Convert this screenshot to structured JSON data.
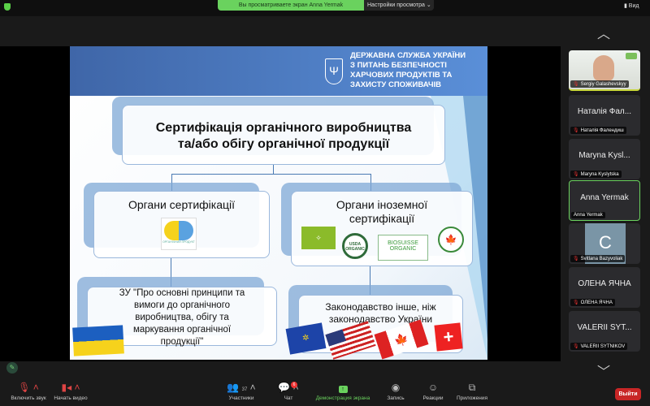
{
  "topbar": {
    "sharing_text": "Вы просматриваете экран Anna Yermak",
    "view_options": "Настройки просмотра",
    "view_button": "Вид"
  },
  "slide": {
    "agency": [
      "ДЕРЖАВНА СЛУЖБА УКРАЇНИ",
      "З ПИТАНЬ БЕЗПЕЧНОСТІ",
      "ХАРЧОВИХ ПРОДУКТІВ  ТА",
      "ЗАХИСТУ СПОЖИВАЧІВ"
    ],
    "title": [
      "Сертифікація органічного виробництва",
      "та/або обігу органічної продукції"
    ],
    "left_box": "Органи сертифікації",
    "right_box": [
      "Органи іноземної",
      "сертифікації"
    ],
    "left_bottom": [
      "ЗУ \"Про основні принципи та",
      "вимоги до органічного",
      "виробництва, обігу та",
      "маркування органічної",
      "продукції\""
    ],
    "right_bottom": [
      "Законодавство інше, ніж",
      "законодавство України"
    ],
    "logos": {
      "ua_organic": "ОРГАНІЧНИЙ ПРОДУКТ",
      "usda": "USDA ORGANIC",
      "biosuisse_1": "BIOSUISSE",
      "biosuisse_2": "ORGANIC"
    }
  },
  "participants": [
    {
      "name": "",
      "label": "Sergiy Galashevskyy",
      "muted": true
    },
    {
      "name": "Наталія Фал...",
      "label": "Наталія Фалендиш",
      "muted": true
    },
    {
      "name": "Maryna Kysl...",
      "label": "Maryna Kyslytska",
      "muted": true
    },
    {
      "name": "Anna Yermak",
      "label": "Anna Yermak",
      "muted": false
    },
    {
      "name": "C",
      "label": "Svitlana Bazyvoliak",
      "muted": true
    },
    {
      "name": "ОЛЕНА ЯЧНА",
      "label": "ОЛЕНА ЯЧНА",
      "muted": true
    },
    {
      "name": "VALERII SYT...",
      "label": "VALERII SYTNIKOV",
      "muted": true
    }
  ],
  "toolbar": {
    "unmute": "Включить звук",
    "start_video": "Начать видео",
    "participants": "Участники",
    "participants_count": "37",
    "chat": "Чат",
    "chat_badge": "6",
    "share": "Демонстрация экрана",
    "record": "Запись",
    "reactions": "Реакции",
    "apps": "Приложения",
    "leave": "Выйти"
  },
  "colors": {
    "accent": "#6ad25e",
    "leave": "#c82626",
    "banner": "#3f66a8"
  }
}
